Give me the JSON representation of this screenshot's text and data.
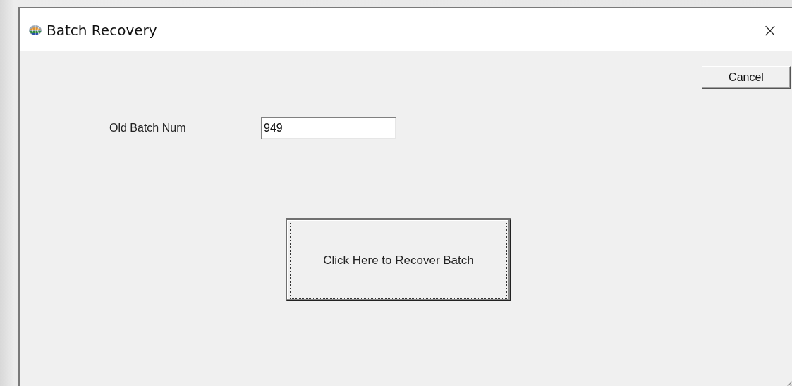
{
  "window": {
    "title": "Batch Recovery",
    "close": "×"
  },
  "cancel_button": {
    "label": "Cancel"
  },
  "field": {
    "label": "Old Batch Num",
    "value": "949"
  },
  "recover_button": {
    "label": "Click Here to Recover Batch",
    "focused": true
  }
}
